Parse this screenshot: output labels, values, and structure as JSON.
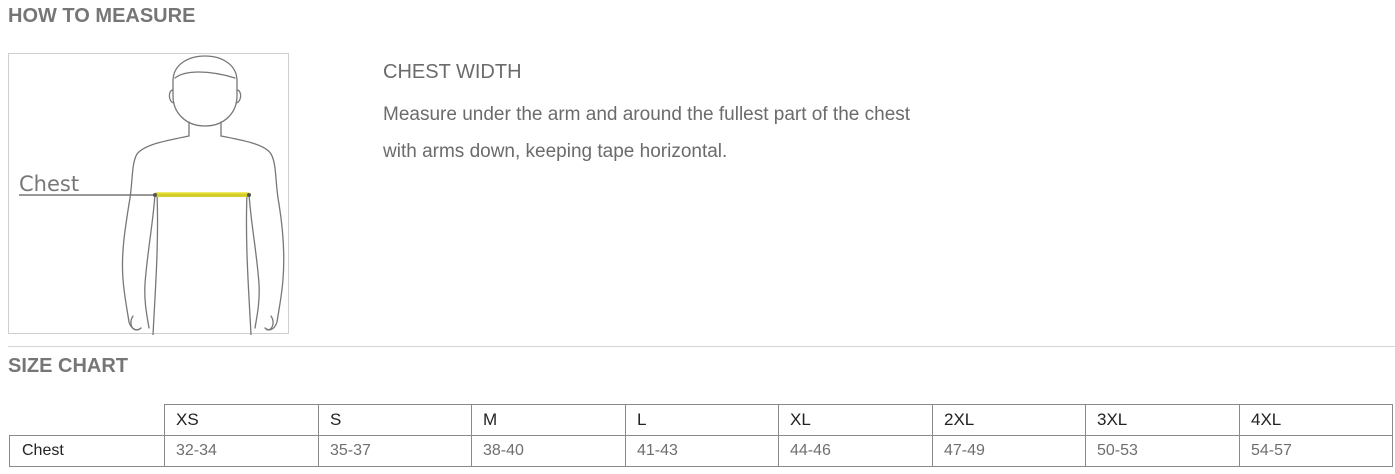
{
  "how_to_measure": {
    "title": "HOW TO MEASURE",
    "figure_label": "Chest",
    "measure_heading": "CHEST WIDTH",
    "measure_line1": "Measure under the arm and around the fullest part of the chest",
    "measure_line2": "with arms down, keeping tape horizontal."
  },
  "size_chart": {
    "title": "SIZE CHART",
    "sizes": [
      "XS",
      "S",
      "M",
      "L",
      "XL",
      "2XL",
      "3XL",
      "4XL"
    ],
    "rows": [
      {
        "label": "Chest",
        "values": [
          "32-34",
          "35-37",
          "38-40",
          "41-43",
          "44-46",
          "47-49",
          "50-53",
          "54-57"
        ]
      }
    ]
  },
  "colors": {
    "tape": "#e8e23a",
    "title_text": "#767676",
    "border": "#8a8a8a"
  }
}
